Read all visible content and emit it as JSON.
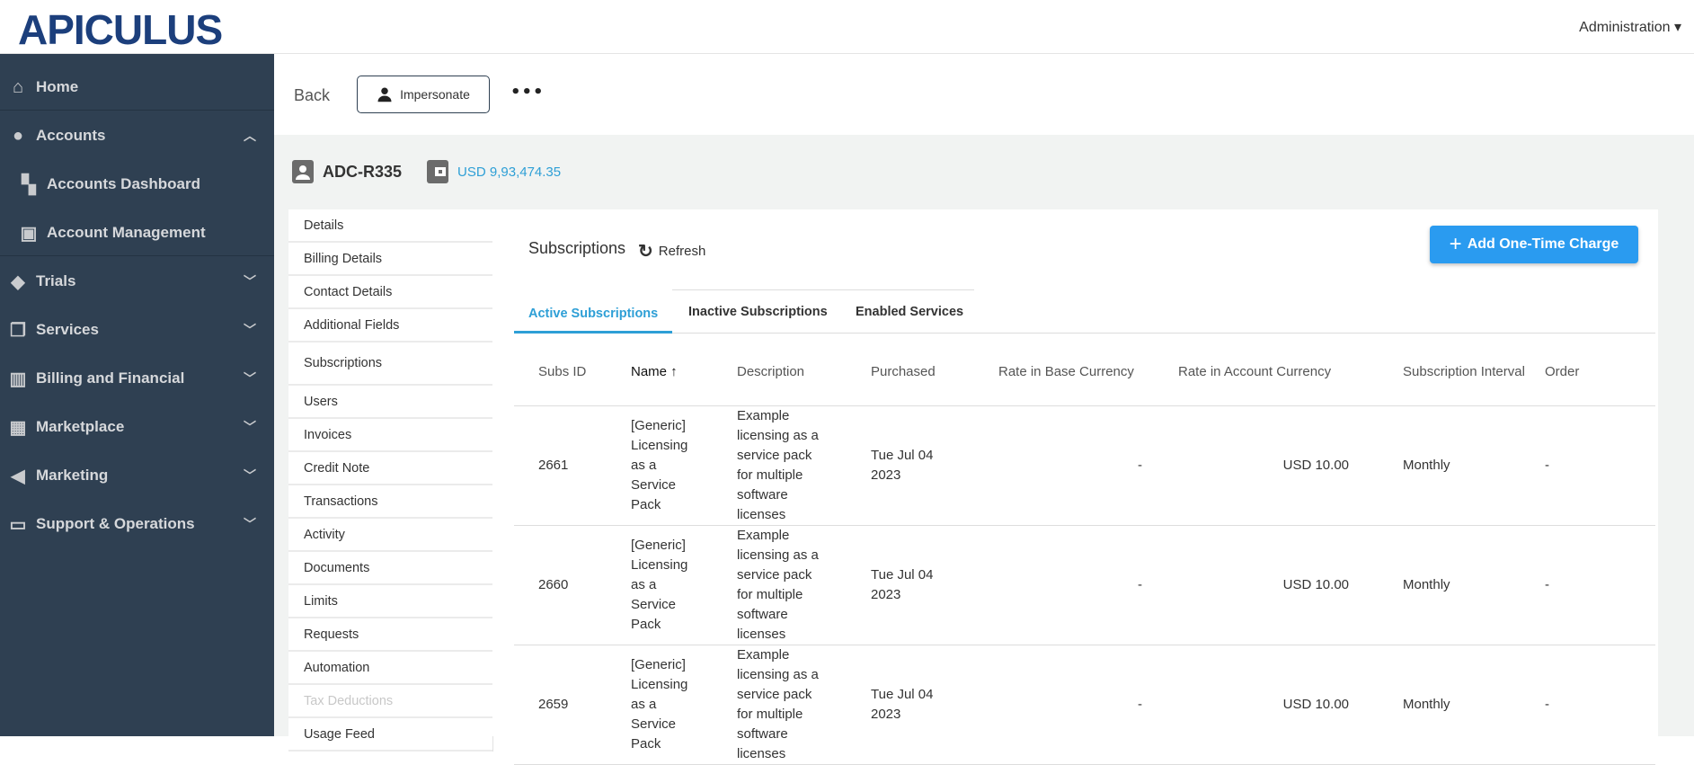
{
  "header": {
    "logo": "APICULUS",
    "admin_menu": "Administration ▾"
  },
  "sidebar": {
    "items": [
      {
        "label": "Home",
        "icon": "home-icon",
        "glyph": "⌂"
      },
      {
        "label": "Accounts",
        "icon": "user-circle-icon",
        "glyph": "●",
        "chev": "︿"
      },
      {
        "label": "Accounts Dashboard",
        "icon": "dashboard-icon",
        "glyph": "▚"
      },
      {
        "label": "Account Management",
        "icon": "account-card-icon",
        "glyph": "▣"
      },
      {
        "label": "Trials",
        "icon": "tag-icon",
        "glyph": "◆",
        "chev": "﹀"
      },
      {
        "label": "Services",
        "icon": "library-icon",
        "glyph": "❐",
        "chev": "﹀"
      },
      {
        "label": "Billing and Financial",
        "icon": "bank-icon",
        "glyph": "▥",
        "chev": "﹀"
      },
      {
        "label": "Marketplace",
        "icon": "store-icon",
        "glyph": "▦",
        "chev": "﹀"
      },
      {
        "label": "Marketing",
        "icon": "megaphone-icon",
        "glyph": "◀",
        "chev": "﹀"
      },
      {
        "label": "Support & Operations",
        "icon": "monitor-icon",
        "glyph": "▭",
        "chev": "﹀"
      }
    ]
  },
  "actions": {
    "back": "Back",
    "impersonate": "Impersonate",
    "more": "•••"
  },
  "account": {
    "id": "ADC-R335",
    "balance": "USD 9,93,474.35"
  },
  "submenu": [
    "Details",
    "Billing Details",
    "Contact Details",
    "Additional Fields",
    "Subscriptions",
    "Users",
    "Invoices",
    "Credit Note",
    "Transactions",
    "Activity",
    "Documents",
    "Limits",
    "Requests",
    "Automation",
    "Tax Deductions",
    "Usage Feed"
  ],
  "panel": {
    "title": "Subscriptions",
    "refresh": "Refresh",
    "add_button": "Add One-Time Charge"
  },
  "tabs": [
    "Active Subscriptions",
    "Inactive Subscriptions",
    "Enabled Services"
  ],
  "table": {
    "headers": [
      "Subs ID",
      "Name ↑",
      "Description",
      "Purchased",
      "Rate in Base Currency",
      "Rate in Account Currency",
      "Subscription Interval",
      "Order"
    ],
    "rows": [
      [
        "2661",
        "[Generic] Licensing as a Service Pack",
        "Example licensing as a service pack for multiple software licenses",
        "Tue Jul 04 2023",
        "-",
        "USD 10.00",
        "Monthly",
        "-"
      ],
      [
        "2660",
        "[Generic] Licensing as a Service Pack",
        "Example licensing as a service pack for multiple software licenses",
        "Tue Jul 04 2023",
        "-",
        "USD 10.00",
        "Monthly",
        "-"
      ],
      [
        "2659",
        "[Generic] Licensing as a Service Pack",
        "Example licensing as a service pack for multiple software licenses",
        "Tue Jul 04 2023",
        "-",
        "USD 10.00",
        "Monthly",
        "-"
      ]
    ]
  }
}
